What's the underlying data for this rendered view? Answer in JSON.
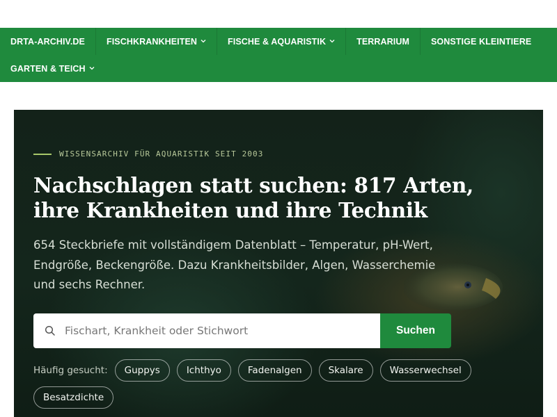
{
  "nav": {
    "items": [
      {
        "label": "DRTA-ARCHIV.DE",
        "dropdown": false
      },
      {
        "label": "FISCHKRANKHEITEN",
        "dropdown": true
      },
      {
        "label": "FISCHE & AQUARISTIK",
        "dropdown": true
      },
      {
        "label": "TERRARIUM",
        "dropdown": false
      },
      {
        "label": "SONSTIGE KLEINTIERE",
        "dropdown": false
      },
      {
        "label": "GARTEN & TEICH",
        "dropdown": true
      }
    ],
    "chevron": "⌄",
    "color": "#1f8a3d"
  },
  "hero": {
    "eyebrow": "WISSENSARCHIV FÜR AQUARISTIK SEIT 2003",
    "title_line1": "Nachschlagen statt suchen: 817 Arten,",
    "title_line2": "ihre Krankheiten und ihre Technik",
    "subtitle_line1": "654 Steckbriefe mit vollständigem Datenblatt – Temperatur, pH-Wert,",
    "subtitle_line2": "Endgröße, Beckengröße. Dazu Krankheitsbilder, Algen, Wasserchemie",
    "subtitle_line3": "und sechs Rechner."
  },
  "search": {
    "placeholder": "Fischart, Krankheit oder Stichwort",
    "value": "",
    "button_label": "Suchen",
    "icon": "search-icon"
  },
  "tags": {
    "label": "Häufig gesucht:",
    "items": [
      "Guppys",
      "Ichthyo",
      "Fadenalgen",
      "Skalare",
      "Wasserwechsel",
      "Besatzdichte"
    ]
  },
  "colors": {
    "accent": "#1f8a3d",
    "hero_bg": "#14261c",
    "eyebrow_line": "#a8c86a"
  }
}
